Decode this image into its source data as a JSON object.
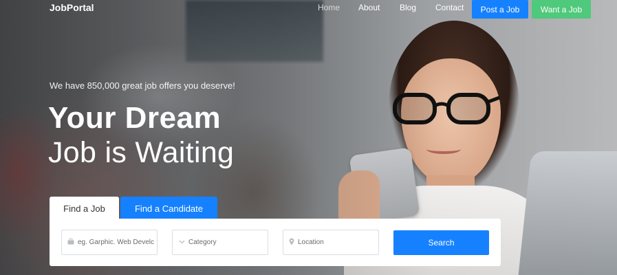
{
  "brand": {
    "name": "JobPortal"
  },
  "nav": {
    "home": "Home",
    "about": "About",
    "blog": "Blog",
    "contact": "Contact",
    "post_job": "Post a Job",
    "want_job": "Want a Job"
  },
  "hero": {
    "tagline": "We have 850,000 great job offers you deserve!",
    "headline_line1": "Your Dream",
    "headline_line2": "Job is Waiting"
  },
  "search": {
    "tabs": [
      {
        "label": "Find a Job",
        "active": true
      },
      {
        "label": "Find a Candidate",
        "active": false
      }
    ],
    "keyword_placeholder": "eg. Garphic. Web Develc",
    "category_label": "Category",
    "location_placeholder": "Location",
    "button_label": "Search"
  },
  "icons": {
    "keyword": "briefcase-icon",
    "category": "chevron-down-icon",
    "location": "map-pin-icon"
  },
  "colors": {
    "primary": "#1681ff",
    "success": "#4fc97b",
    "text_light": "#ffffff"
  }
}
